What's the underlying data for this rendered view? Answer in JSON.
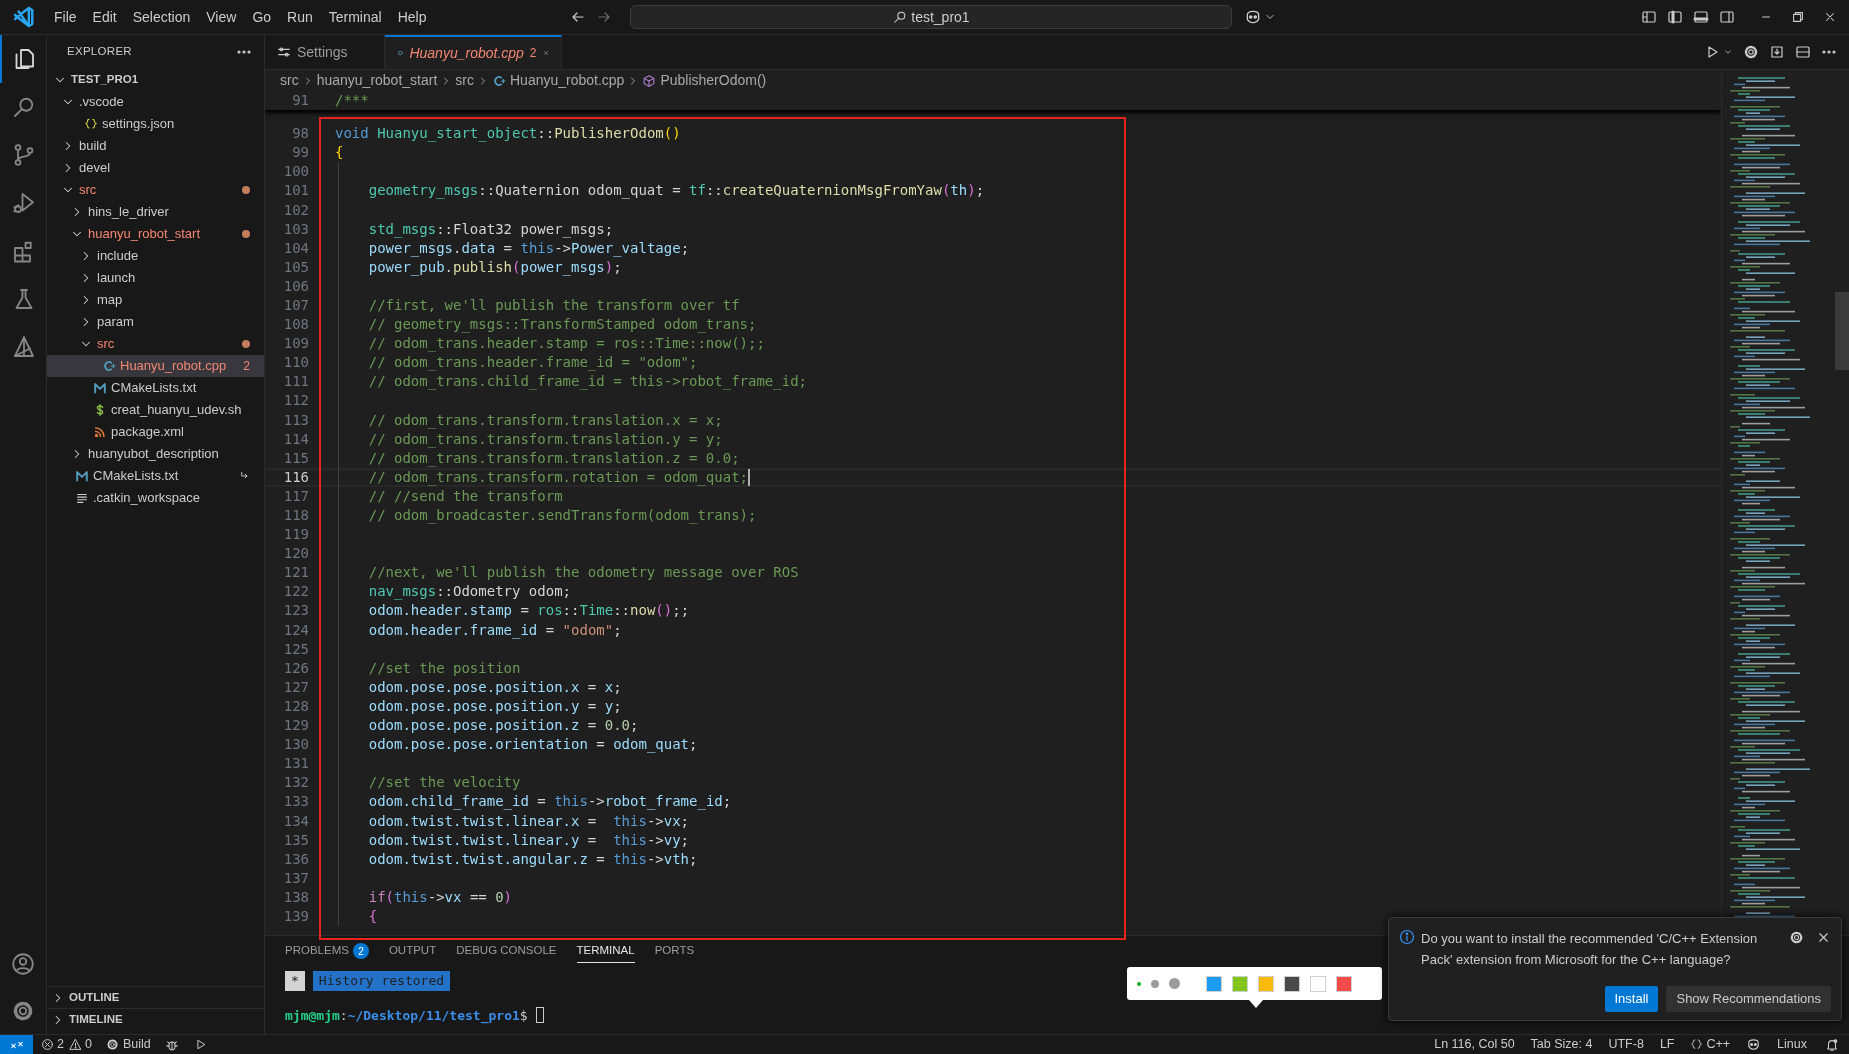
{
  "title_bar": {
    "menus": [
      "File",
      "Edit",
      "Selection",
      "View",
      "Go",
      "Run",
      "Terminal",
      "Help"
    ],
    "search": "test_pro1"
  },
  "activity_bar": {
    "items": [
      {
        "kind": "explorer",
        "selected": true
      },
      {
        "kind": "search",
        "selected": false
      },
      {
        "kind": "source-control",
        "selected": false
      },
      {
        "kind": "run",
        "selected": false
      },
      {
        "kind": "extensions",
        "selected": false
      },
      {
        "kind": "testing",
        "selected": false
      },
      {
        "kind": "ros",
        "selected": false
      }
    ],
    "bottom": [
      {
        "kind": "account"
      },
      {
        "kind": "settings"
      }
    ]
  },
  "sidebar": {
    "title": "EXPLORER",
    "root": {
      "name": "TEST_PRO1",
      "expanded": true,
      "children": [
        {
          "kind": "folder",
          "name": ".vscode",
          "expanded": true,
          "error": false,
          "selected": false,
          "children": [
            {
              "kind": "json",
              "name": "settings.json",
              "error": false,
              "selected": false
            }
          ]
        },
        {
          "kind": "folder",
          "name": "build",
          "expanded": false,
          "error": false,
          "selected": false
        },
        {
          "kind": "folder",
          "name": "devel",
          "expanded": false,
          "error": false,
          "selected": false
        },
        {
          "kind": "folder",
          "name": "src",
          "expanded": true,
          "error": true,
          "selected": false,
          "children": [
            {
              "kind": "folder",
              "name": "hins_le_driver",
              "expanded": false,
              "error": false,
              "selected": false
            },
            {
              "kind": "folder",
              "name": "huanyu_robot_start",
              "expanded": true,
              "error": true,
              "selected": false,
              "children": [
                {
                  "kind": "folder",
                  "name": "include",
                  "expanded": false,
                  "error": false,
                  "selected": false
                },
                {
                  "kind": "folder",
                  "name": "launch",
                  "expanded": false,
                  "error": false,
                  "selected": false
                },
                {
                  "kind": "folder",
                  "name": "map",
                  "expanded": false,
                  "error": false,
                  "selected": false
                },
                {
                  "kind": "folder",
                  "name": "param",
                  "expanded": false,
                  "error": false,
                  "selected": false
                },
                {
                  "kind": "folder",
                  "name": "src",
                  "expanded": true,
                  "error": true,
                  "selected": false,
                  "children": [
                    {
                      "kind": "cpp",
                      "name": "Huanyu_robot.cpp",
                      "error": true,
                      "selected": true,
                      "badge": "2"
                    }
                  ]
                },
                {
                  "kind": "cmake",
                  "name": "CMakeLists.txt",
                  "error": false,
                  "selected": false
                },
                {
                  "kind": "shell",
                  "name": "creat_huanyu_udev.sh",
                  "error": false,
                  "selected": false
                },
                {
                  "kind": "xml",
                  "name": "package.xml",
                  "error": false,
                  "selected": false
                }
              ]
            },
            {
              "kind": "folder",
              "name": "huanyubot_description",
              "expanded": false,
              "error": false,
              "selected": false
            }
          ]
        },
        {
          "kind": "cmake",
          "name": "CMakeLists.txt",
          "error": false,
          "selected": false,
          "linked": true
        },
        {
          "kind": "text",
          "name": ".catkin_workspace",
          "error": false,
          "selected": false
        }
      ]
    },
    "sections": [
      {
        "label": "OUTLINE",
        "expanded": false
      },
      {
        "label": "TIMELINE",
        "expanded": false
      }
    ]
  },
  "editor": {
    "tabs": [
      {
        "kind": "settings",
        "label": "Settings",
        "selected": false,
        "preview": false,
        "error": false
      },
      {
        "kind": "cpp",
        "label": "Huanyu_robot.cpp",
        "selected": true,
        "preview": true,
        "error": true,
        "badge": "2"
      }
    ],
    "breadcrumb": [
      {
        "kind": "folder",
        "label": "src"
      },
      {
        "kind": "folder",
        "label": "huanyu_robot_start"
      },
      {
        "kind": "folder",
        "label": "src"
      },
      {
        "kind": "cpp",
        "label": "Huanyu_robot.cpp"
      },
      {
        "kind": "symbol",
        "label": "PublisherOdom()"
      }
    ],
    "sticky_line": {
      "number": "91",
      "tokens": [
        {
          "kind": "cmt",
          "text": "/***"
        }
      ]
    },
    "lines": [
      {
        "number": "98",
        "current": false,
        "tokens": [
          {
            "kind": "kw",
            "text": "void "
          },
          {
            "kind": "type",
            "text": "Huanyu_start_object"
          },
          {
            "kind": "plain",
            "text": "::"
          },
          {
            "kind": "fn",
            "text": "PublisherOdom"
          },
          {
            "kind": "b1",
            "text": "()"
          }
        ]
      },
      {
        "number": "99",
        "current": false,
        "tokens": [
          {
            "kind": "b1",
            "text": "{"
          }
        ]
      },
      {
        "number": "100",
        "current": false
      },
      {
        "number": "101",
        "current": false,
        "tokens": [
          {
            "kind": "type",
            "text": "    geometry_msgs"
          },
          {
            "kind": "plain",
            "text": "::Quaternion odom_quat = "
          },
          {
            "kind": "type",
            "text": "tf"
          },
          {
            "kind": "plain",
            "text": "::"
          },
          {
            "kind": "fn",
            "text": "createQuaternionMsgFromYaw"
          },
          {
            "kind": "b2",
            "text": "("
          },
          {
            "kind": "var",
            "text": "th"
          },
          {
            "kind": "b2",
            "text": ")"
          },
          {
            "kind": "plain",
            "text": ";"
          }
        ]
      },
      {
        "number": "102",
        "current": false
      },
      {
        "number": "103",
        "current": false,
        "tokens": [
          {
            "kind": "type",
            "text": "    std_msgs"
          },
          {
            "kind": "plain",
            "text": "::Float32 power_msgs;"
          }
        ]
      },
      {
        "number": "104",
        "current": false,
        "tokens": [
          {
            "kind": "var",
            "text": "    power_msgs"
          },
          {
            "kind": "plain",
            "text": "."
          },
          {
            "kind": "var",
            "text": "data"
          },
          {
            "kind": "plain",
            "text": " = "
          },
          {
            "kind": "kw",
            "text": "this"
          },
          {
            "kind": "plain",
            "text": "->"
          },
          {
            "kind": "var",
            "text": "Power_valtage"
          },
          {
            "kind": "plain",
            "text": ";"
          }
        ]
      },
      {
        "number": "105",
        "current": false,
        "tokens": [
          {
            "kind": "var",
            "text": "    power_pub"
          },
          {
            "kind": "plain",
            "text": "."
          },
          {
            "kind": "fn",
            "text": "publish"
          },
          {
            "kind": "b2",
            "text": "("
          },
          {
            "kind": "var",
            "text": "power_msgs"
          },
          {
            "kind": "b2",
            "text": ")"
          },
          {
            "kind": "plain",
            "text": ";"
          }
        ]
      },
      {
        "number": "106",
        "current": false
      },
      {
        "number": "107",
        "current": false,
        "tokens": [
          {
            "kind": "cmt",
            "text": "    //first, we'll publish the transform over tf"
          }
        ]
      },
      {
        "number": "108",
        "current": false,
        "tokens": [
          {
            "kind": "cmt",
            "text": "    // geometry_msgs::TransformStamped odom_trans;"
          }
        ]
      },
      {
        "number": "109",
        "current": false,
        "tokens": [
          {
            "kind": "cmt",
            "text": "    // odom_trans.header.stamp = ros::Time::now();;"
          }
        ]
      },
      {
        "number": "110",
        "current": false,
        "tokens": [
          {
            "kind": "cmt",
            "text": "    // odom_trans.header.frame_id = \"odom\";"
          }
        ]
      },
      {
        "number": "111",
        "current": false,
        "tokens": [
          {
            "kind": "cmt",
            "text": "    // odom_trans.child_frame_id = this->robot_frame_id;"
          }
        ]
      },
      {
        "number": "112",
        "current": false
      },
      {
        "number": "113",
        "current": false,
        "tokens": [
          {
            "kind": "cmt",
            "text": "    // odom_trans.transform.translation.x = x;"
          }
        ]
      },
      {
        "number": "114",
        "current": false,
        "tokens": [
          {
            "kind": "cmt",
            "text": "    // odom_trans.transform.translation.y = y;"
          }
        ]
      },
      {
        "number": "115",
        "current": false,
        "tokens": [
          {
            "kind": "cmt",
            "text": "    // odom_trans.transform.translation.z = 0.0;"
          }
        ]
      },
      {
        "number": "116",
        "current": true,
        "tokens": [
          {
            "kind": "cmt",
            "text": "    // odom_trans.transform.rotation = odom_quat;"
          }
        ]
      },
      {
        "number": "117",
        "current": false,
        "tokens": [
          {
            "kind": "cmt",
            "text": "    // //send the transform"
          }
        ]
      },
      {
        "number": "118",
        "current": false,
        "tokens": [
          {
            "kind": "cmt",
            "text": "    // odom_broadcaster.sendTransform(odom_trans);"
          }
        ]
      },
      {
        "number": "119",
        "current": false
      },
      {
        "number": "120",
        "current": false
      },
      {
        "number": "121",
        "current": false,
        "tokens": [
          {
            "kind": "cmt",
            "text": "    //next, we'll publish the odometry message over ROS"
          }
        ]
      },
      {
        "number": "122",
        "current": false,
        "tokens": [
          {
            "kind": "type",
            "text": "    nav_msgs"
          },
          {
            "kind": "plain",
            "text": "::Odometry odom;"
          }
        ]
      },
      {
        "number": "123",
        "current": false,
        "tokens": [
          {
            "kind": "var",
            "text": "    odom.header.stamp"
          },
          {
            "kind": "plain",
            "text": " = "
          },
          {
            "kind": "type",
            "text": "ros"
          },
          {
            "kind": "plain",
            "text": "::"
          },
          {
            "kind": "type",
            "text": "Time"
          },
          {
            "kind": "plain",
            "text": "::"
          },
          {
            "kind": "fn",
            "text": "now"
          },
          {
            "kind": "b2",
            "text": "()"
          },
          {
            "kind": "plain",
            "text": ";;"
          }
        ]
      },
      {
        "number": "124",
        "current": false,
        "tokens": [
          {
            "kind": "var",
            "text": "    odom.header.frame_id"
          },
          {
            "kind": "plain",
            "text": " = "
          },
          {
            "kind": "str",
            "text": "\"odom\""
          },
          {
            "kind": "plain",
            "text": ";"
          }
        ]
      },
      {
        "number": "125",
        "current": false
      },
      {
        "number": "126",
        "current": false,
        "tokens": [
          {
            "kind": "cmt",
            "text": "    //set the position"
          }
        ]
      },
      {
        "number": "127",
        "current": false,
        "tokens": [
          {
            "kind": "var",
            "text": "    odom.pose.pose.position.x"
          },
          {
            "kind": "plain",
            "text": " = "
          },
          {
            "kind": "var",
            "text": "x"
          },
          {
            "kind": "plain",
            "text": ";"
          }
        ]
      },
      {
        "number": "128",
        "current": false,
        "tokens": [
          {
            "kind": "var",
            "text": "    odom.pose.pose.position.y"
          },
          {
            "kind": "plain",
            "text": " = "
          },
          {
            "kind": "var",
            "text": "y"
          },
          {
            "kind": "plain",
            "text": ";"
          }
        ]
      },
      {
        "number": "129",
        "current": false,
        "tokens": [
          {
            "kind": "var",
            "text": "    odom.pose.pose.position.z"
          },
          {
            "kind": "plain",
            "text": " = "
          },
          {
            "kind": "num",
            "text": "0.0"
          },
          {
            "kind": "plain",
            "text": ";"
          }
        ]
      },
      {
        "number": "130",
        "current": false,
        "tokens": [
          {
            "kind": "var",
            "text": "    odom.pose.pose.orientation"
          },
          {
            "kind": "plain",
            "text": " = "
          },
          {
            "kind": "var",
            "text": "odom_quat"
          },
          {
            "kind": "plain",
            "text": ";"
          }
        ]
      },
      {
        "number": "131",
        "current": false
      },
      {
        "number": "132",
        "current": false,
        "tokens": [
          {
            "kind": "cmt",
            "text": "    //set the velocity"
          }
        ]
      },
      {
        "number": "133",
        "current": false,
        "tokens": [
          {
            "kind": "var",
            "text": "    odom.child_frame_id"
          },
          {
            "kind": "plain",
            "text": " = "
          },
          {
            "kind": "kw",
            "text": "this"
          },
          {
            "kind": "plain",
            "text": "->"
          },
          {
            "kind": "var",
            "text": "robot_frame_id"
          },
          {
            "kind": "plain",
            "text": ";"
          }
        ]
      },
      {
        "number": "134",
        "current": false,
        "tokens": [
          {
            "kind": "var",
            "text": "    odom.twist.twist.linear.x"
          },
          {
            "kind": "plain",
            "text": " =  "
          },
          {
            "kind": "kw",
            "text": "this"
          },
          {
            "kind": "plain",
            "text": "->"
          },
          {
            "kind": "var",
            "text": "vx"
          },
          {
            "kind": "plain",
            "text": ";"
          }
        ]
      },
      {
        "number": "135",
        "current": false,
        "tokens": [
          {
            "kind": "var",
            "text": "    odom.twist.twist.linear.y"
          },
          {
            "kind": "plain",
            "text": " =  "
          },
          {
            "kind": "kw",
            "text": "this"
          },
          {
            "kind": "plain",
            "text": "->"
          },
          {
            "kind": "var",
            "text": "vy"
          },
          {
            "kind": "plain",
            "text": ";"
          }
        ]
      },
      {
        "number": "136",
        "current": false,
        "tokens": [
          {
            "kind": "var",
            "text": "    odom.twist.twist.angular.z"
          },
          {
            "kind": "plain",
            "text": " = "
          },
          {
            "kind": "kw",
            "text": "this"
          },
          {
            "kind": "plain",
            "text": "->"
          },
          {
            "kind": "var",
            "text": "vth"
          },
          {
            "kind": "plain",
            "text": ";"
          }
        ]
      },
      {
        "number": "137",
        "current": false
      },
      {
        "number": "138",
        "current": false,
        "tokens": [
          {
            "kind": "ctl",
            "text": "    if"
          },
          {
            "kind": "b2",
            "text": "("
          },
          {
            "kind": "kw",
            "text": "this"
          },
          {
            "kind": "plain",
            "text": "->"
          },
          {
            "kind": "var",
            "text": "vx"
          },
          {
            "kind": "plain",
            "text": " == "
          },
          {
            "kind": "num",
            "text": "0"
          },
          {
            "kind": "b2",
            "text": ")"
          }
        ]
      },
      {
        "number": "139",
        "current": false,
        "tokens": [
          {
            "kind": "b2",
            "text": "    {"
          }
        ]
      }
    ],
    "annotation": {
      "kind": "rectangle"
    }
  },
  "panel": {
    "tabs": [
      {
        "label": "PROBLEMS",
        "selected": false,
        "badge": "2"
      },
      {
        "label": "OUTPUT",
        "selected": false
      },
      {
        "label": "DEBUG CONSOLE",
        "selected": false
      },
      {
        "label": "TERMINAL",
        "selected": true
      },
      {
        "label": "PORTS",
        "selected": false
      }
    ],
    "terminal": [
      {
        "tokens": [
          {
            "kind": "marker",
            "text": "*"
          },
          {
            "kind": "banner",
            "text": "History restored"
          }
        ]
      },
      {
        "tokens": [
          {
            "kind": "user",
            "text": "mjm@mjm"
          },
          {
            "kind": "plain",
            "text": ":"
          },
          {
            "kind": "path",
            "text": "~/Desktop/11/test_pro1"
          },
          {
            "kind": "plain",
            "text": "$"
          }
        ],
        "cursor": true
      }
    ]
  },
  "annotation_toolbar": {
    "sizes": [
      {
        "selected": true
      },
      {
        "selected": false
      },
      {
        "selected": false
      }
    ],
    "colors": [
      {
        "color": "#1d9bf0"
      },
      {
        "color": "#7fc61b"
      },
      {
        "color": "#f9b90b"
      },
      {
        "color": "#4a4a4a"
      },
      {
        "color": "#ffffff"
      },
      {
        "color": "#f24b4b"
      }
    ]
  },
  "notification": {
    "message": "Do you want to install the recommended 'C/C++ Extension Pack' extension from Microsoft for the C++ language?",
    "buttons": [
      {
        "label": "Install",
        "primary": true
      },
      {
        "label": "Show Recommendations",
        "primary": false
      }
    ]
  },
  "status_bar": {
    "left": [
      {
        "kind": "remote"
      },
      {
        "kind": "problems",
        "errors": "2",
        "warnings": "0"
      },
      {
        "kind": "build",
        "text": "Build"
      },
      {
        "kind": "debug"
      },
      {
        "kind": "run"
      }
    ],
    "right": [
      {
        "kind": "text",
        "text": "Ln 116, Col 50"
      },
      {
        "kind": "text",
        "text": "Tab Size: 4"
      },
      {
        "kind": "text",
        "text": "UTF-8"
      },
      {
        "kind": "text",
        "text": "LF"
      },
      {
        "kind": "language",
        "text": "C++"
      },
      {
        "kind": "copilot"
      },
      {
        "kind": "text",
        "text": "Linux"
      },
      {
        "kind": "bell"
      }
    ]
  }
}
